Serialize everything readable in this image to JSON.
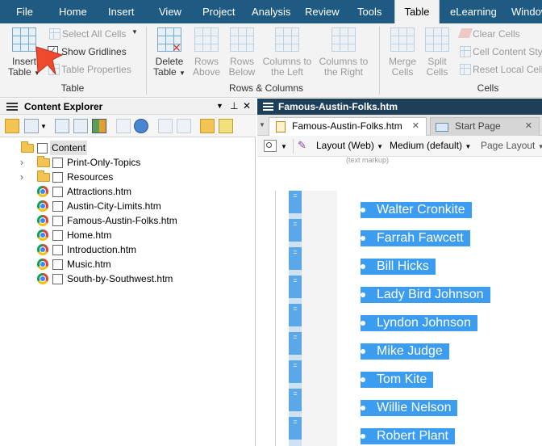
{
  "menu": {
    "items": [
      "File",
      "Home",
      "Insert",
      "View",
      "Project",
      "Analysis",
      "Review",
      "Tools",
      "Table",
      "eLearning",
      "Window"
    ],
    "active": "Table"
  },
  "ribbon": {
    "table_group": {
      "label": "Table",
      "insert_table_line1": "Insert",
      "insert_table_line2": "Table",
      "select_all_cells": "Select All Cells",
      "show_gridlines": "Show Gridlines",
      "table_properties": "Table Properties"
    },
    "rows_columns_group": {
      "label": "Rows & Columns",
      "delete_table_line1": "Delete",
      "delete_table_line2": "Table",
      "rows_above_line1": "Rows",
      "rows_above_line2": "Above",
      "rows_below_line1": "Rows",
      "rows_below_line2": "Below",
      "columns_left_line1": "Columns to",
      "columns_left_line2": "the Left",
      "columns_right_line1": "Columns to",
      "columns_right_line2": "the Right"
    },
    "cells_group": {
      "label": "Cells",
      "merge_cells_line1": "Merge",
      "merge_cells_line2": "Cells",
      "split_cells_line1": "Split",
      "split_cells_line2": "Cells",
      "clear_cells": "Clear Cells",
      "cell_content_style": "Cell Content Style",
      "reset_local_cell": "Reset Local Cell"
    }
  },
  "content_explorer": {
    "title": "Content Explorer",
    "tree": [
      {
        "label": "Content",
        "type": "folder",
        "level": 0,
        "selected": true,
        "expandable": false
      },
      {
        "label": "Print-Only-Topics",
        "type": "folder",
        "level": 1,
        "expandable": true
      },
      {
        "label": "Resources",
        "type": "folder",
        "level": 1,
        "expandable": true
      },
      {
        "label": "Attractions.htm",
        "type": "file",
        "level": 1
      },
      {
        "label": "Austin-City-Limits.htm",
        "type": "file",
        "level": 1
      },
      {
        "label": "Famous-Austin-Folks.htm",
        "type": "file",
        "level": 1
      },
      {
        "label": "Home.htm",
        "type": "file",
        "level": 1
      },
      {
        "label": "Introduction.htm",
        "type": "file",
        "level": 1
      },
      {
        "label": "Music.htm",
        "type": "file",
        "level": 1
      },
      {
        "label": "South-by-Southwest.htm",
        "type": "file",
        "level": 1
      }
    ]
  },
  "editor": {
    "title": "Famous-Austin-Folks.htm",
    "tabs": [
      {
        "label": "Famous-Austin-Folks.htm",
        "active": true
      },
      {
        "label": "Start Page",
        "active": false
      }
    ],
    "layout_dropdown": "Layout (Web)",
    "medium_dropdown": "Medium (default)",
    "page_layout_dropdown": "Page Layout",
    "markup_label": "(text markup)",
    "column_marker_glyph": "=",
    "names": [
      "Walter Cronkite",
      "Farrah Fawcett",
      "Bill Hicks",
      "Lady Bird Johnson",
      "Lyndon Johnson",
      "Mike Judge",
      "Tom Kite",
      "Willie Nelson",
      "Robert Plant"
    ]
  },
  "colors": {
    "menubar": "#1e5a82",
    "doc_header": "#1e3f5a",
    "selection": "#3b9cf0",
    "column_marker": "#5aa8e8",
    "cursor_arrow": "#f04a2e"
  },
  "icons": {
    "insert_table": "table-grid-icon",
    "cursor": "arrow-pointer-icon",
    "tree_folder": "folder-icon",
    "tree_file": "chrome-icon"
  }
}
